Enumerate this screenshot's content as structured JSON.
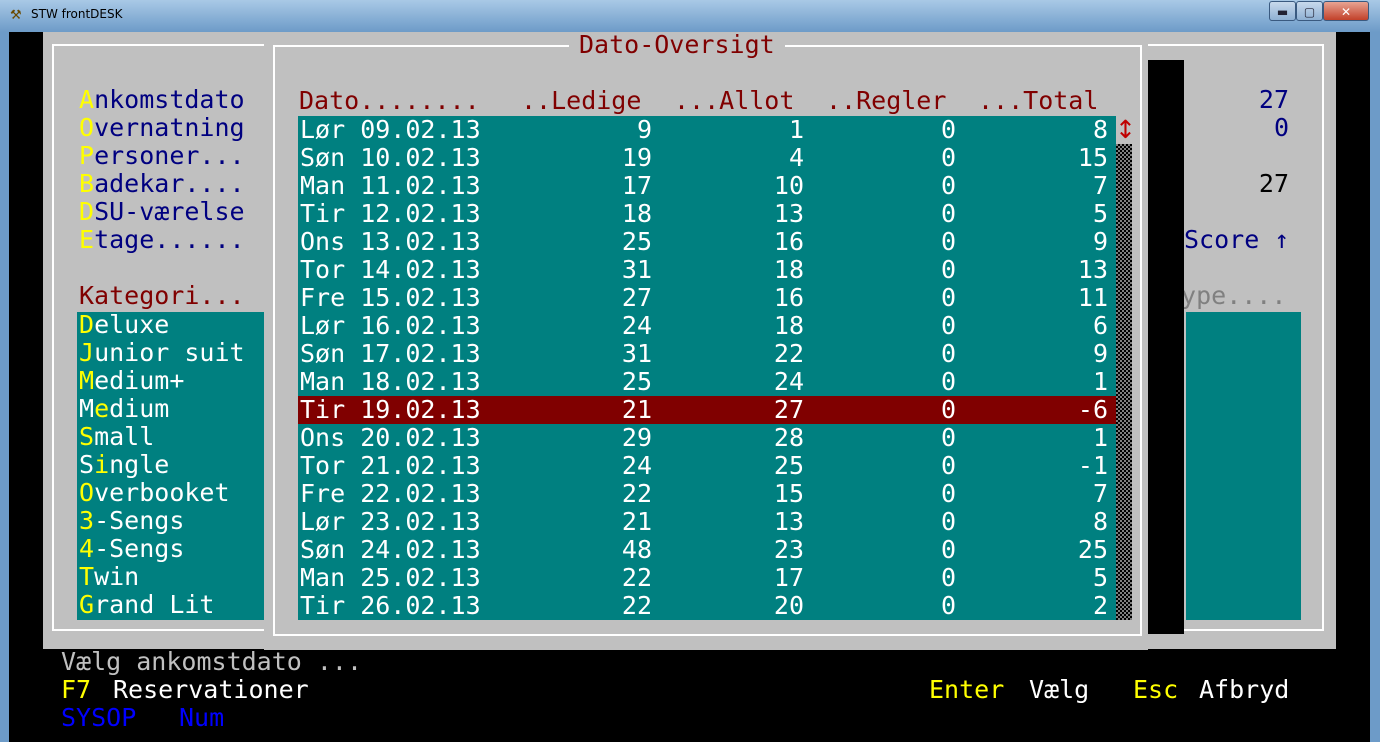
{
  "window": {
    "title": "STW frontDESK",
    "min_glyph": "▬",
    "max_glyph": "▢",
    "close_glyph": "✕"
  },
  "form": {
    "labels": [
      {
        "hot": "A",
        "rest": "nkomstdato"
      },
      {
        "hot": "O",
        "rest": "vernatning"
      },
      {
        "hot": "P",
        "rest": "ersoner..."
      },
      {
        "hot": "B",
        "rest": "adekar...."
      },
      {
        "hot": "D",
        "rest": "SU-værelse"
      },
      {
        "hot": "E",
        "rest": "tage......"
      }
    ],
    "right_values": [
      "27",
      "0",
      "",
      "27"
    ],
    "score_label": "Score ↑",
    "kategori_label": "Kategori...",
    "type_label": "Type....",
    "categories": [
      {
        "hot": "D",
        "rest": "eluxe"
      },
      {
        "hot": "J",
        "rest": "unior suit"
      },
      {
        "hot": "M",
        "rest": "edium+"
      },
      {
        "pre": "M",
        "hot": "e",
        "rest": "dium"
      },
      {
        "hot": "S",
        "rest": "mall"
      },
      {
        "pre": "S",
        "hot": "i",
        "rest": "ngle"
      },
      {
        "hot": "O",
        "rest": "verbooket"
      },
      {
        "hot": "3",
        "rest": "-Sengs"
      },
      {
        "hot": "4",
        "rest": "-Sengs"
      },
      {
        "hot": "T",
        "rest": "win"
      },
      {
        "hot": "G",
        "rest": "rand Lit"
      }
    ]
  },
  "popup": {
    "title": "Dato-Oversigt",
    "headers": {
      "dato": "Dato........",
      "ledige": "..Ledige",
      "allot": "...Allot",
      "regler": "..Regler",
      "total": "...Total"
    },
    "scroll_arrow": "↕",
    "selected_index": 10,
    "rows": [
      {
        "date": "Lør 09.02.13",
        "ledige": "9",
        "allot": "1",
        "regler": "0",
        "total": "8"
      },
      {
        "date": "Søn 10.02.13",
        "ledige": "19",
        "allot": "4",
        "regler": "0",
        "total": "15"
      },
      {
        "date": "Man 11.02.13",
        "ledige": "17",
        "allot": "10",
        "regler": "0",
        "total": "7"
      },
      {
        "date": "Tir 12.02.13",
        "ledige": "18",
        "allot": "13",
        "regler": "0",
        "total": "5"
      },
      {
        "date": "Ons 13.02.13",
        "ledige": "25",
        "allot": "16",
        "regler": "0",
        "total": "9"
      },
      {
        "date": "Tor 14.02.13",
        "ledige": "31",
        "allot": "18",
        "regler": "0",
        "total": "13"
      },
      {
        "date": "Fre 15.02.13",
        "ledige": "27",
        "allot": "16",
        "regler": "0",
        "total": "11"
      },
      {
        "date": "Lør 16.02.13",
        "ledige": "24",
        "allot": "18",
        "regler": "0",
        "total": "6"
      },
      {
        "date": "Søn 17.02.13",
        "ledige": "31",
        "allot": "22",
        "regler": "0",
        "total": "9"
      },
      {
        "date": "Man 18.02.13",
        "ledige": "25",
        "allot": "24",
        "regler": "0",
        "total": "1"
      },
      {
        "date": "Tir 19.02.13",
        "ledige": "21",
        "allot": "27",
        "regler": "0",
        "total": "-6"
      },
      {
        "date": "Ons 20.02.13",
        "ledige": "29",
        "allot": "28",
        "regler": "0",
        "total": "1"
      },
      {
        "date": "Tor 21.02.13",
        "ledige": "24",
        "allot": "25",
        "regler": "0",
        "total": "-1"
      },
      {
        "date": "Fre 22.02.13",
        "ledige": "22",
        "allot": "15",
        "regler": "0",
        "total": "7"
      },
      {
        "date": "Lør 23.02.13",
        "ledige": "21",
        "allot": "13",
        "regler": "0",
        "total": "8"
      },
      {
        "date": "Søn 24.02.13",
        "ledige": "48",
        "allot": "23",
        "regler": "0",
        "total": "25"
      },
      {
        "date": "Man 25.02.13",
        "ledige": "22",
        "allot": "17",
        "regler": "0",
        "total": "5"
      },
      {
        "date": "Tir 26.02.13",
        "ledige": "22",
        "allot": "20",
        "regler": "0",
        "total": "2"
      }
    ]
  },
  "status": {
    "prompt": "Vælg ankomstdato ...",
    "f7_key": "F7",
    "f7_label": "Reservationer",
    "enter_key": "Enter",
    "enter_label": "Vælg",
    "esc_key": "Esc",
    "esc_label": "Afbryd",
    "user": "SYSOP",
    "num": "Num"
  }
}
